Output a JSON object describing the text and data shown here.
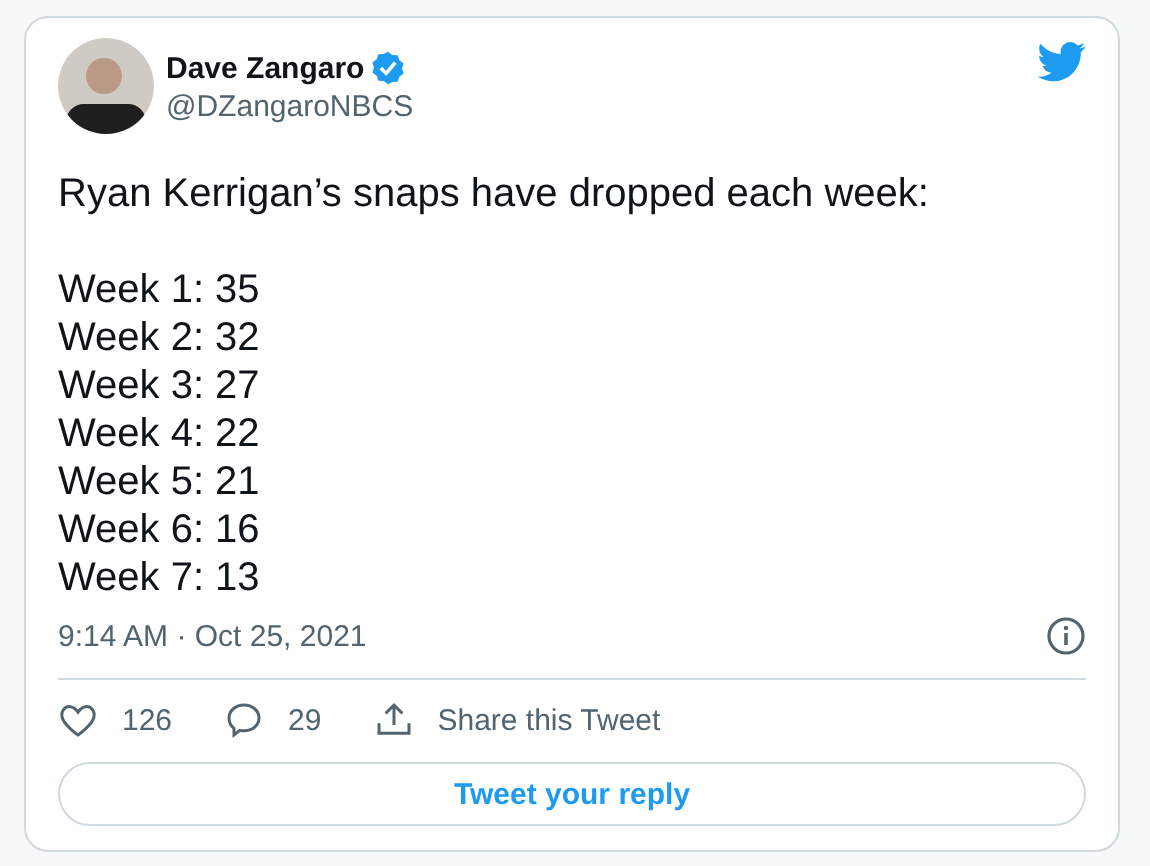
{
  "author": {
    "name": "Dave Zangaro",
    "verified": true,
    "handle": "@DZangaroNBCS"
  },
  "intro": "Ryan Kerrigan’s snaps have dropped each week:",
  "lines": [
    "Week 1: 35",
    "Week 2: 32",
    "Week 3: 27",
    "Week 4: 22",
    "Week 5: 21",
    "Week 6: 16",
    "Week 7: 13"
  ],
  "timestamp": "9:14 AM · Oct 25, 2021",
  "actions": [
    {
      "kind": "like",
      "label": "126"
    },
    {
      "kind": "reply",
      "label": "29"
    },
    {
      "kind": "share",
      "label": "Share this Tweet"
    }
  ],
  "reply_button": "Tweet your reply"
}
